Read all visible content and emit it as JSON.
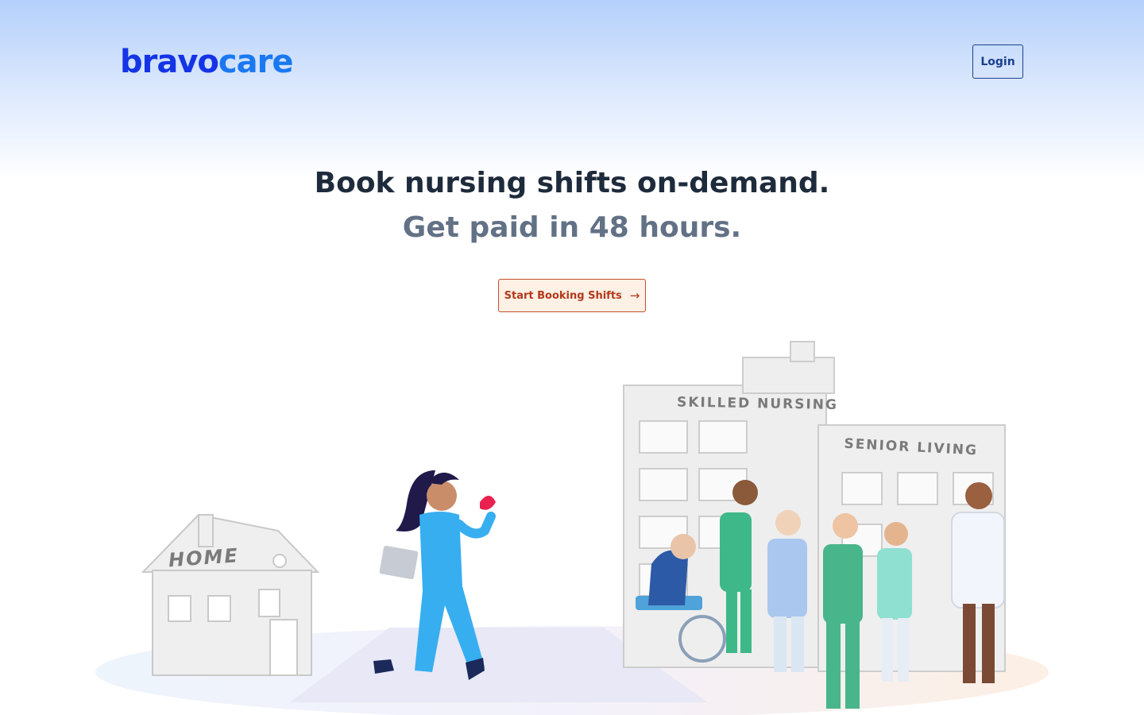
{
  "header": {
    "logo": {
      "part1": "bravo",
      "part2": "care"
    },
    "login_label": "Login"
  },
  "hero": {
    "headline": "Book nursing shifts on-demand.",
    "subheadline": "Get paid in 48 hours.",
    "cta_label": "Start Booking Shifts",
    "cta_icon": "arrow-right-icon"
  },
  "illustration": {
    "home_sign": "HOME",
    "skilled_sign": "SKILLED NURSING",
    "senior_sign": "SENIOR LIVING"
  },
  "colors": {
    "brand_dark": "#1434e6",
    "brand_light": "#1a78f0",
    "cta_border": "#c2502b",
    "cta_text": "#b2391d",
    "cta_bg": "#fdf0e4",
    "headline": "#1e2b3c",
    "subheadline": "#627185"
  }
}
